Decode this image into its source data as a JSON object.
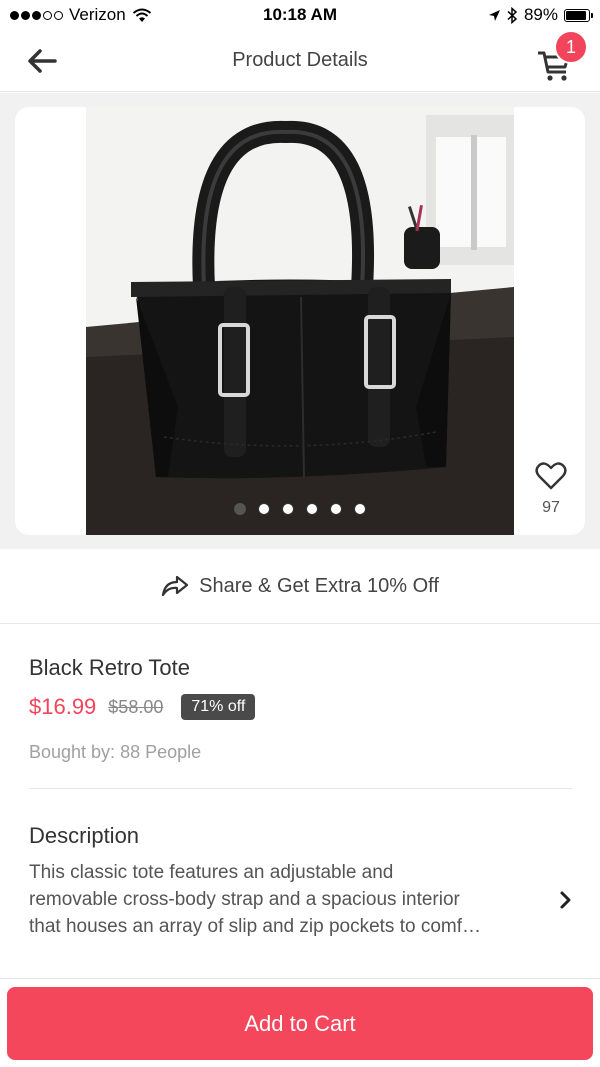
{
  "status_bar": {
    "carrier": "Verizon",
    "time": "10:18 AM",
    "battery": "89%",
    "battery_level": 0.89,
    "signal_dots_filled": 3,
    "signal_dots_total": 5
  },
  "nav": {
    "title": "Product Details",
    "cart_count": "1"
  },
  "gallery": {
    "image_name": "black-retro-tote-photo",
    "likes": "97",
    "page_count": 6,
    "active_page": 0
  },
  "share": {
    "label": "Share & Get Extra 10% Off"
  },
  "product": {
    "name": "Black Retro Tote",
    "price": "$16.99",
    "original_price": "$58.00",
    "discount": "71% off",
    "bought_by": "Bought by: 88 People"
  },
  "description": {
    "heading": "Description",
    "lines": [
      "This classic tote features an adjustable and",
      "removable cross-body strap and a spacious interior",
      "that houses an array of slip and zip pockets to comf…"
    ]
  },
  "actions": {
    "add_to_cart": "Add to Cart"
  },
  "colors": {
    "accent": "#f4475c",
    "badge": "#4a4a4a",
    "background": "#f1f1f1"
  },
  "icons": {
    "back": "arrow-left-icon",
    "cart": "shopping-cart-icon",
    "like": "heart-icon",
    "share": "share-arrow-icon",
    "expand": "chevron-right-icon",
    "wifi": "wifi-icon",
    "location": "location-arrow-icon",
    "bluetooth": "bluetooth-icon"
  }
}
